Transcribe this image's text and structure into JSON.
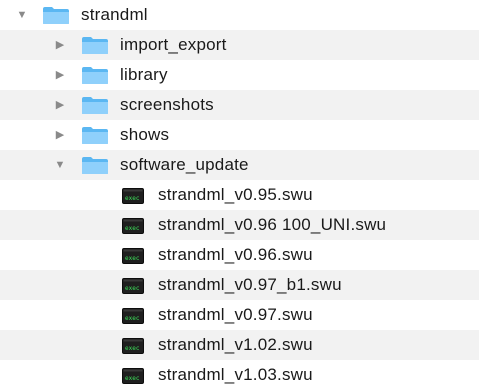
{
  "icons": {
    "folder": "folder-icon",
    "executable": "terminal-executable-icon",
    "expanded": "disclosure-triangle-expanded-icon",
    "collapsed": "disclosure-triangle-collapsed-icon"
  },
  "colors": {
    "folder_body": "#5bb7f2",
    "folder_tab": "#8fd0fb",
    "stripe": "#f2f2f2",
    "triangle": "#8a8a8a"
  },
  "tree": {
    "root": {
      "label": "strandml",
      "expanded": true
    },
    "folders": [
      {
        "label": "import_export",
        "expanded": false
      },
      {
        "label": "library",
        "expanded": false
      },
      {
        "label": "screenshots",
        "expanded": false
      },
      {
        "label": "shows",
        "expanded": false
      },
      {
        "label": "software_update",
        "expanded": true
      }
    ],
    "files": [
      {
        "label": "strandml_v0.95.swu"
      },
      {
        "label": "strandml_v0.96 100_UNI.swu"
      },
      {
        "label": "strandml_v0.96.swu"
      },
      {
        "label": "strandml_v0.97_b1.swu"
      },
      {
        "label": "strandml_v0.97.swu"
      },
      {
        "label": "strandml_v1.02.swu"
      },
      {
        "label": "strandml_v1.03.swu"
      }
    ]
  }
}
